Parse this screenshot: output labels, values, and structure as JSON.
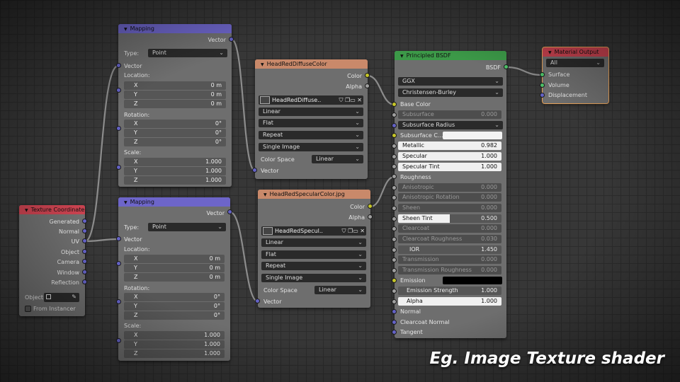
{
  "caption": "Eg. Image Texture shader",
  "mapping1": {
    "title": "Mapping",
    "out_vector": "Vector",
    "type_label": "Type:",
    "type_value": "Point",
    "in_vector": "Vector",
    "location_label": "Location:",
    "location": [
      [
        "X",
        "0 m"
      ],
      [
        "Y",
        "0 m"
      ],
      [
        "Z",
        "0 m"
      ]
    ],
    "rotation_label": "Rotation:",
    "rotation": [
      [
        "X",
        "0°"
      ],
      [
        "Y",
        "0°"
      ],
      [
        "Z",
        "0°"
      ]
    ],
    "scale_label": "Scale:",
    "scale": [
      [
        "X",
        "1.000"
      ],
      [
        "Y",
        "1.000"
      ],
      [
        "Z",
        "1.000"
      ]
    ]
  },
  "mapping2": {
    "title": "Mapping",
    "out_vector": "Vector",
    "type_label": "Type:",
    "type_value": "Point",
    "in_vector": "Vector",
    "location_label": "Location:",
    "location": [
      [
        "X",
        "0 m"
      ],
      [
        "Y",
        "0 m"
      ],
      [
        "Z",
        "0 m"
      ]
    ],
    "rotation_label": "Rotation:",
    "rotation": [
      [
        "X",
        "0°"
      ],
      [
        "Y",
        "0°"
      ],
      [
        "Z",
        "0°"
      ]
    ],
    "scale_label": "Scale:",
    "scale": [
      [
        "X",
        "1.000"
      ],
      [
        "Y",
        "1.000"
      ],
      [
        "Z",
        "1.000"
      ]
    ]
  },
  "image1": {
    "title": "HeadRedDiffuseColor",
    "out_color": "Color",
    "out_alpha": "Alpha",
    "image_name": "HeadRedDiffuse..",
    "interpolation": "Linear",
    "projection": "Flat",
    "extension": "Repeat",
    "source": "Single Image",
    "color_space_label": "Color Space",
    "color_space": "Linear",
    "in_vector": "Vector"
  },
  "image2": {
    "title": "HeadRedSpecularColor.jpg",
    "out_color": "Color",
    "out_alpha": "Alpha",
    "image_name": "HeadRedSpecul..",
    "interpolation": "Linear",
    "projection": "Flat",
    "extension": "Repeat",
    "source": "Single Image",
    "color_space_label": "Color Space",
    "color_space": "Linear",
    "in_vector": "Vector"
  },
  "texcoord": {
    "title": "Texture Coordinate",
    "outputs": [
      "Generated",
      "Normal",
      "UV",
      "Object",
      "Camera",
      "Window",
      "Reflection"
    ],
    "object_label": "Object",
    "from_instancer": "From Instancer"
  },
  "bsdf": {
    "title": "Principled BSDF",
    "out_bsdf": "BSDF",
    "distribution": "GGX",
    "subsurface_method": "Christensen-Burley",
    "base_color": "Base Color",
    "subsurface_label": "Subsurface",
    "subsurface_value": "0.000",
    "subsurface_radius": "Subsurface Radius",
    "subsurface_color": "Subsurface C...",
    "metallic_label": "Metallic",
    "metallic_value": "0.982",
    "specular_label": "Specular",
    "specular_value": "1.000",
    "specular_tint_label": "Specular Tint",
    "specular_tint_value": "1.000",
    "roughness": "Roughness",
    "anisotropic_label": "Anisotropic",
    "anisotropic_value": "0.000",
    "aniso_rot_label": "Anisotropic Rotation",
    "aniso_rot_value": "0.000",
    "sheen_label": "Sheen",
    "sheen_value": "0.000",
    "sheen_tint_label": "Sheen Tint",
    "sheen_tint_value": "0.500",
    "clearcoat_label": "Clearcoat",
    "clearcoat_value": "0.000",
    "clearcoat_rough_label": "Clearcoat Roughness",
    "clearcoat_rough_value": "0.030",
    "ior_label": "IOR",
    "ior_value": "1.450",
    "transmission_label": "Transmission",
    "transmission_value": "0.000",
    "trans_rough_label": "Transmission Roughness",
    "trans_rough_value": "0.000",
    "emission": "Emission",
    "emission_strength_label": "Emission Strength",
    "emission_strength_value": "1.000",
    "alpha_label": "Alpha",
    "alpha_value": "1.000",
    "normal": "Normal",
    "clearcoat_normal": "Clearcoat Normal",
    "tangent": "Tangent"
  },
  "output": {
    "title": "Material Output",
    "target": "All",
    "surface": "Surface",
    "volume": "Volume",
    "displacement": "Displacement"
  },
  "colors": {
    "vector_socket": "#6462c6",
    "color_socket": "#c6c629",
    "shader_socket": "#4fc56a",
    "value_socket": "#a0a0a0"
  }
}
